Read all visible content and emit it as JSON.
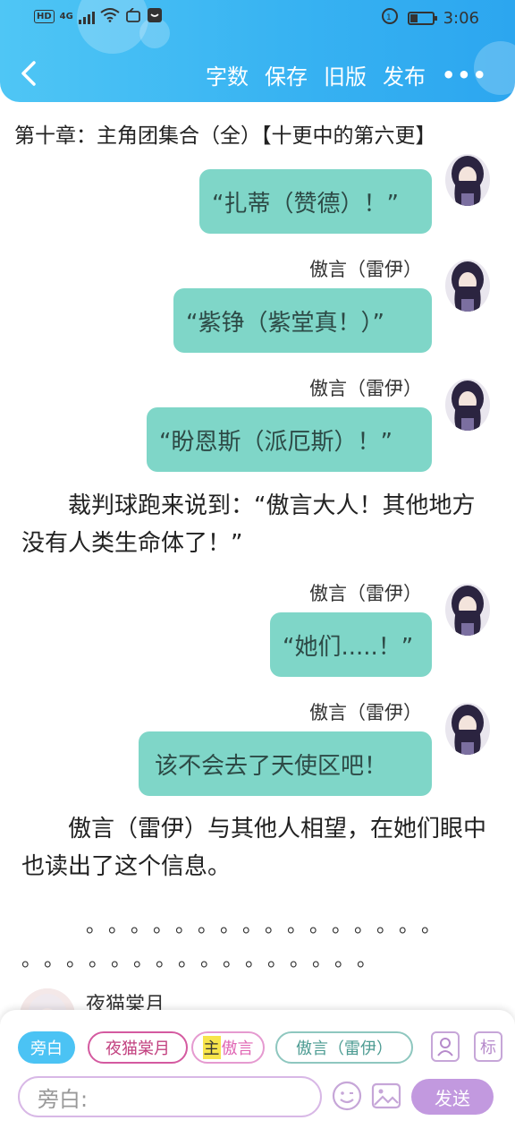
{
  "status_bar": {
    "hd": "HD",
    "network": "4G",
    "time": "3:06",
    "battery_level": 0.35
  },
  "toolbar": {
    "items": [
      "字数",
      "保存",
      "旧版",
      "发布"
    ],
    "more": "•••"
  },
  "chapter": {
    "title": "第十章：主角团集合（全）【十更中的第六更】"
  },
  "messages": [
    {
      "speaker": "",
      "text": "“扎蒂（赞德）！”"
    },
    {
      "speaker": "傲言（雷伊）",
      "text": "“紫铮（紫堂真！）”"
    },
    {
      "speaker": "傲言（雷伊）",
      "text": "“盼恩斯（派厄斯）！”"
    },
    {
      "speaker": "傲言（雷伊）",
      "text": "“她们.....！”"
    },
    {
      "speaker": "傲言（雷伊）",
      "text": "该不会去了天使区吧！"
    }
  ],
  "narration": [
    "　　裁判球跑来说到：“傲言大人！其他地方没有人类生命体了！”",
    "　　傲言（雷伊）与其他人相望，在她们眼中也读出了这个信息。"
  ],
  "dots_line1": "　　。。。。。。。。。。。。。。。。",
  "dots_line2": "。。。。。。。。。。。。。。。。",
  "next_speaker": "夜猫棠月",
  "composer": {
    "roles": {
      "narration": "旁白",
      "cat": "夜猫棠月",
      "main_tag": "主",
      "main_name": "傲言",
      "lei": "傲言（雷伊）"
    },
    "mark_label": "标",
    "placeholder": "旁白:",
    "send": "发送"
  },
  "colors": {
    "header": "#38b3f2",
    "bubble": "#7fd6c8",
    "send": "#c299df",
    "narration_chip": "#4bc3f4"
  },
  "icons": [
    "back-arrow-icon",
    "wifi-icon",
    "signal-icon",
    "battery-icon",
    "person-icon",
    "emoji-icon",
    "image-icon"
  ]
}
